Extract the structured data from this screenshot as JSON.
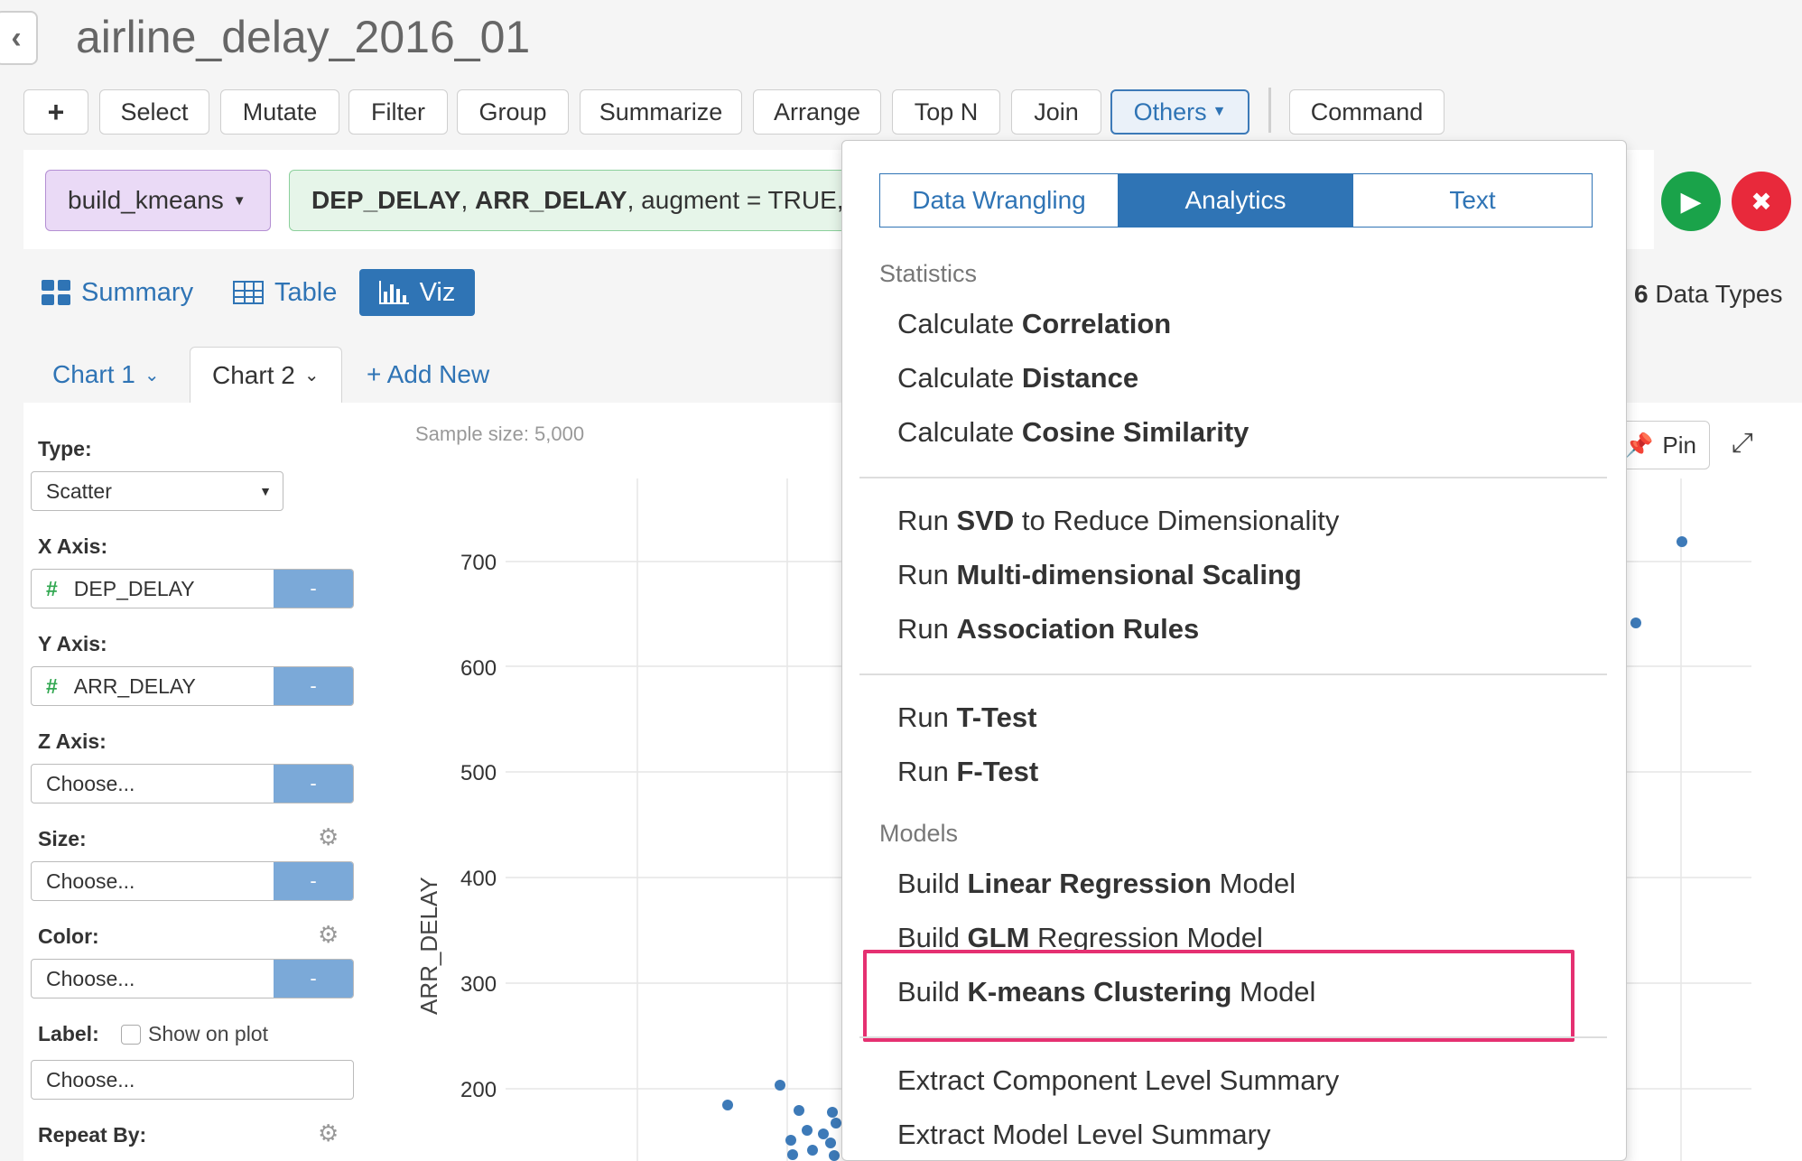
{
  "header": {
    "back_icon": "chevron-left-icon",
    "title": "airline_delay_2016_01"
  },
  "toolbar": {
    "add_label": "+",
    "select": "Select",
    "mutate": "Mutate",
    "filter": "Filter",
    "group": "Group",
    "summarize": "Summarize",
    "arrange": "Arrange",
    "topn": "Top N",
    "join": "Join",
    "others": "Others",
    "command": "Command"
  },
  "command": {
    "function": "build_kmeans",
    "arg1": "DEP_DELAY",
    "sep1": ", ",
    "arg2": "ARR_DELAY",
    "rest": ", augment = TRUE,",
    "run_icon": "play-icon",
    "cancel_icon": "close-icon"
  },
  "view_tabs": {
    "summary": "Summary",
    "table": "Table",
    "viz": "Viz"
  },
  "chart_tabs": {
    "chart1": "Chart 1",
    "chart2": "Chart 2",
    "add_new": "+ Add New"
  },
  "left_panel": {
    "type_label": "Type:",
    "type_value": "Scatter",
    "x_label": "X Axis:",
    "x_value": "DEP_DELAY",
    "y_label": "Y Axis:",
    "y_value": "ARR_DELAY",
    "z_label": "Z Axis:",
    "z_value": "Choose...",
    "size_label": "Size:",
    "size_value": "Choose...",
    "color_label": "Color:",
    "color_value": "Choose...",
    "label_label": "Label:",
    "show_on_plot": "Show on plot",
    "label_value": "Choose...",
    "repeat_label": "Repeat By:",
    "dash": "-"
  },
  "plot": {
    "sample_size": "Sample size: 5,000",
    "y_axis_label": "ARR_DELAY",
    "y_ticks": [
      "700",
      "600",
      "500",
      "400",
      "300",
      "200"
    ],
    "pin": "Pin",
    "data_types_count": "6",
    "data_types_label": " Data Types"
  },
  "menu": {
    "tabs": [
      "Data Wrangling",
      "Analytics",
      "Text"
    ],
    "active_tab": "Analytics",
    "section_statistics": "Statistics",
    "corr_pre": "Calculate ",
    "corr_bold": "Correlation",
    "dist_pre": "Calculate ",
    "dist_bold": "Distance",
    "cos_pre": "Calculate ",
    "cos_bold": "Cosine Similarity",
    "svd_pre": "Run ",
    "svd_bold": "SVD",
    "svd_post": " to Reduce Dimensionality",
    "mds_pre": "Run ",
    "mds_bold": "Multi-dimensional Scaling",
    "assoc_pre": "Run ",
    "assoc_bold": "Association Rules",
    "ttest_pre": "Run ",
    "ttest_bold": "T-Test",
    "ftest_pre": "Run ",
    "ftest_bold": "F-Test",
    "section_models": "Models",
    "lm_pre": "Build ",
    "lm_bold": "Linear Regression",
    "lm_post": " Model",
    "glm_pre": "Build ",
    "glm_bold": "GLM",
    "glm_post": " Regression Model",
    "km_pre": "Build ",
    "km_bold": "K-means Clustering",
    "km_post": " Model",
    "comp_summary": "Extract Component Level Summary",
    "model_summary": "Extract Model Level Summary"
  },
  "colors": {
    "accent": "#2f74b5",
    "highlight": "#e53071",
    "run": "#1aa34a",
    "cancel": "#e8293b"
  }
}
